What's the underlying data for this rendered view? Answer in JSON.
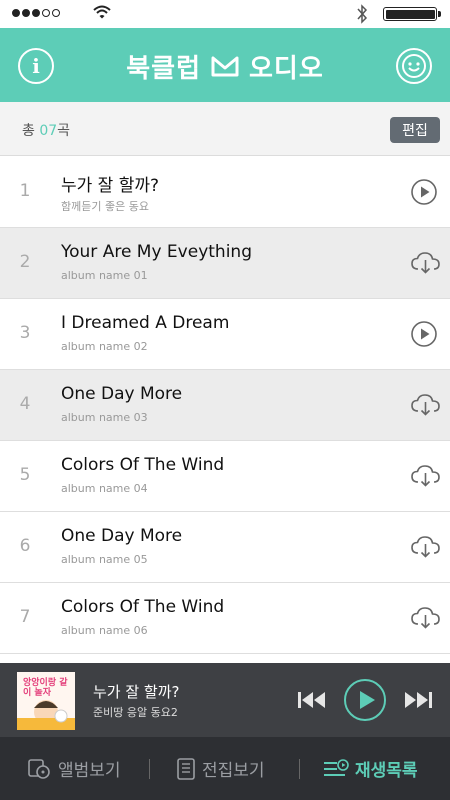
{
  "status_bar": {
    "signal_dots": 5,
    "signal_filled": 3,
    "battery_level": 1.0
  },
  "header": {
    "title_left": "북클럽",
    "title_right": "오디오",
    "icons": {
      "info": "info-icon",
      "logo": "book-icon",
      "profile": "smiley-icon"
    },
    "accent": "#5dcdb7"
  },
  "list_header": {
    "count_prefix": "총 ",
    "count_value": "07",
    "count_suffix": "곡",
    "edit_label": "편집"
  },
  "tracks": [
    {
      "no": "1",
      "title": "누가 잘 할까?",
      "subtitle": "함께듣기 좋은 동요",
      "action": "play",
      "highlighted": false
    },
    {
      "no": "2",
      "title": "Your Are My Eveything",
      "subtitle": "album name 01",
      "action": "download",
      "highlighted": true
    },
    {
      "no": "3",
      "title": "I Dreamed A Dream",
      "subtitle": "album name 02",
      "action": "play",
      "highlighted": false
    },
    {
      "no": "4",
      "title": "One Day More",
      "subtitle": "album name 03",
      "action": "download",
      "highlighted": true
    },
    {
      "no": "5",
      "title": "Colors Of The Wind",
      "subtitle": "album name 04",
      "action": "download",
      "highlighted": false
    },
    {
      "no": "6",
      "title": "One Day More",
      "subtitle": "album name 05",
      "action": "download",
      "highlighted": false
    },
    {
      "no": "7",
      "title": "Colors Of The Wind",
      "subtitle": "album name 06",
      "action": "download",
      "highlighted": false
    }
  ],
  "player": {
    "title": "누가 잘 할까?",
    "subtitle": "준비땅 응알 동요2",
    "cover_text": "앙앙이랑 같이 놀자"
  },
  "tabs": [
    {
      "label": "앨범보기",
      "icon": "album-icon",
      "active": false
    },
    {
      "label": "전집보기",
      "icon": "collection-icon",
      "active": false
    },
    {
      "label": "재생목록",
      "icon": "playlist-icon",
      "active": true
    }
  ]
}
